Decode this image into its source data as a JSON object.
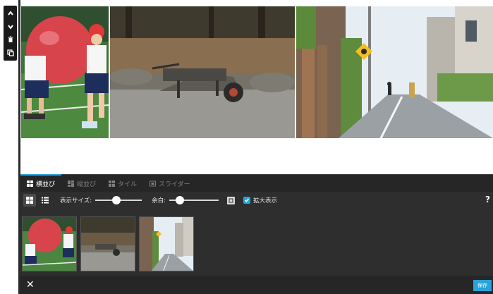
{
  "toolbar": {
    "icons": [
      "chevron-up-icon",
      "chevron-down-icon",
      "trash-icon",
      "copy-icon"
    ]
  },
  "photos": [
    {
      "subject": "children-with-red-ball"
    },
    {
      "subject": "wheelbarrow-on-ground"
    },
    {
      "subject": "street-with-school-sign"
    }
  ],
  "tabs": [
    {
      "label": "横並び",
      "icon": "tiles-icon",
      "active": true
    },
    {
      "label": "縦並び",
      "icon": "columns-icon",
      "active": false
    },
    {
      "label": "タイル",
      "icon": "grid-icon",
      "active": false
    },
    {
      "label": "スライダー",
      "icon": "slider-icon",
      "active": false
    }
  ],
  "options": {
    "display_size_label": "表示サイズ:",
    "display_size_value": 0.45,
    "margin_label": "余白:",
    "margin_value": 0.15,
    "enlarge_label": "拡大表示",
    "enlarge_checked": true,
    "help_label": "?"
  },
  "footer": {
    "close_label": "✕",
    "save_label": "保存"
  },
  "colors": {
    "accent": "#2aa3d8",
    "panel": "#2e2e2e",
    "panel_dark": "#262626",
    "ball_red": "#d8444c"
  }
}
